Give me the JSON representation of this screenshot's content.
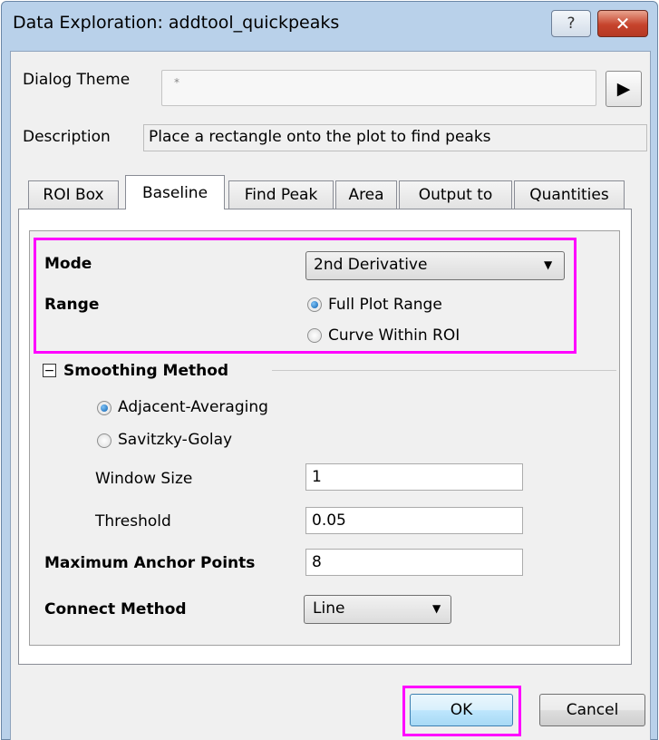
{
  "window": {
    "title": "Data Exploration: addtool_quickpeaks",
    "help_label": "?",
    "close_label": "✕"
  },
  "theme": {
    "label": "Dialog Theme",
    "value": "*",
    "arrow_label": "▶"
  },
  "description": {
    "label": "Description",
    "value": "Place a rectangle onto the plot to find peaks"
  },
  "tabs": [
    {
      "label": "ROI Box",
      "active": false
    },
    {
      "label": "Baseline",
      "active": true
    },
    {
      "label": "Find Peak",
      "active": false
    },
    {
      "label": "Area",
      "active": false
    },
    {
      "label": "Output to",
      "active": false
    },
    {
      "label": "Quantities",
      "active": false
    }
  ],
  "baseline": {
    "mode_label": "Mode",
    "mode_value": "2nd Derivative",
    "range_label": "Range",
    "range_options": [
      {
        "label": "Full Plot Range",
        "selected": true
      },
      {
        "label": "Curve Within ROI",
        "selected": false
      }
    ],
    "smoothing": {
      "title": "Smoothing Method",
      "collapse_symbol": "−",
      "options": [
        {
          "label": "Adjacent-Averaging",
          "selected": true
        },
        {
          "label": "Savitzky-Golay",
          "selected": false
        }
      ],
      "window_size_label": "Window Size",
      "window_size_value": "1",
      "threshold_label": "Threshold",
      "threshold_value": "0.05"
    },
    "max_anchor_label": "Maximum Anchor Points",
    "max_anchor_value": "8",
    "connect_label": "Connect Method",
    "connect_value": "Line"
  },
  "buttons": {
    "ok_label": "OK",
    "cancel_label": "Cancel"
  },
  "colors": {
    "highlight": "#ff00ff",
    "title_bar": "#b9d1ea",
    "close_button": "#c6432c"
  },
  "icons": {
    "dropdown": "▼",
    "arrow": "play-arrow-icon"
  }
}
